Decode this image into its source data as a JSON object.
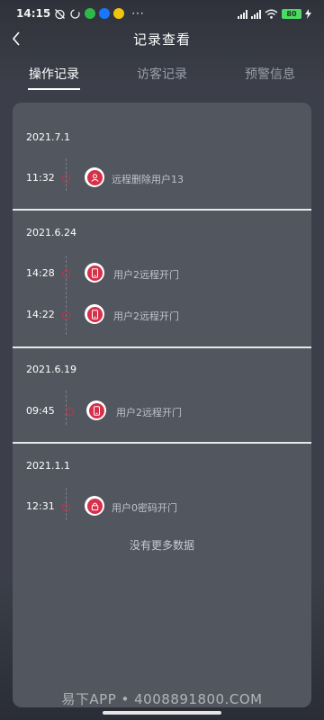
{
  "status_bar": {
    "time": "14:15",
    "more": "···",
    "battery_level": "80",
    "app_icon_colors": [
      "#2fb84a",
      "#1677ff",
      "#f1c40f"
    ]
  },
  "header": {
    "title": "记录查看",
    "back_icon": "chevron-left-icon"
  },
  "tabs": [
    {
      "label": "操作记录",
      "active": true
    },
    {
      "label": "访客记录",
      "active": false
    },
    {
      "label": "预警信息",
      "active": false
    }
  ],
  "records": [
    {
      "date": "2021.7.1",
      "entries": [
        {
          "time": "11:32",
          "icon": "user-delete-icon",
          "text": "远程删除用户13"
        }
      ]
    },
    {
      "date": "2021.6.24",
      "entries": [
        {
          "time": "14:28",
          "icon": "phone-icon",
          "text": "用户2远程开门"
        },
        {
          "time": "14:22",
          "icon": "phone-icon",
          "text": "用户2远程开门"
        }
      ]
    },
    {
      "date": "2021.6.19",
      "entries": [
        {
          "time": "09:45",
          "icon": "phone-icon",
          "text": "用户2远程开门"
        }
      ]
    },
    {
      "date": "2021.1.1",
      "entries": [
        {
          "time": "12:31",
          "icon": "lock-icon",
          "text": "用户0密码开门"
        }
      ]
    }
  ],
  "no_more_text": "没有更多数据",
  "watermark": "易下APP • 4008891800.COM",
  "colors": {
    "accent_red": "#d6314b",
    "card_bg": "#52565f",
    "page_bg": "#3c3f49"
  }
}
